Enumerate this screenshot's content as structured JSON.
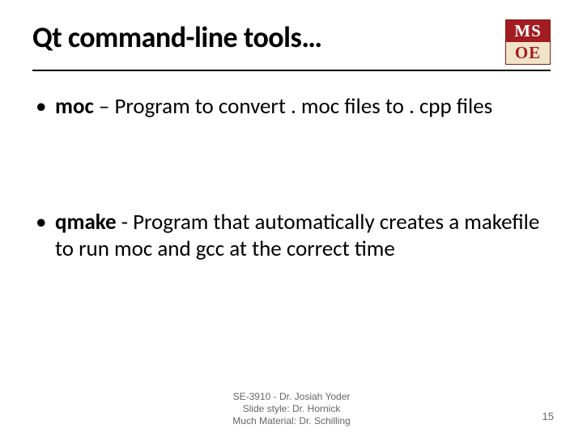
{
  "title": "Qt command-line tools…",
  "logo": {
    "top": "MS",
    "bottom": "OE"
  },
  "bullets": [
    {
      "term": "moc",
      "sep": " – ",
      "desc": "Program to convert . moc files to . cpp files"
    },
    {
      "term": "qmake",
      "sep": " - ",
      "desc": "Program that automatically creates a makefile to run moc and gcc at the correct time"
    }
  ],
  "footer": {
    "line1": "SE-3910  -  Dr. Josiah Yoder",
    "line2": "Slide style: Dr. Hornick",
    "line3": "Much Material: Dr. Schilling"
  },
  "page_number": "15"
}
